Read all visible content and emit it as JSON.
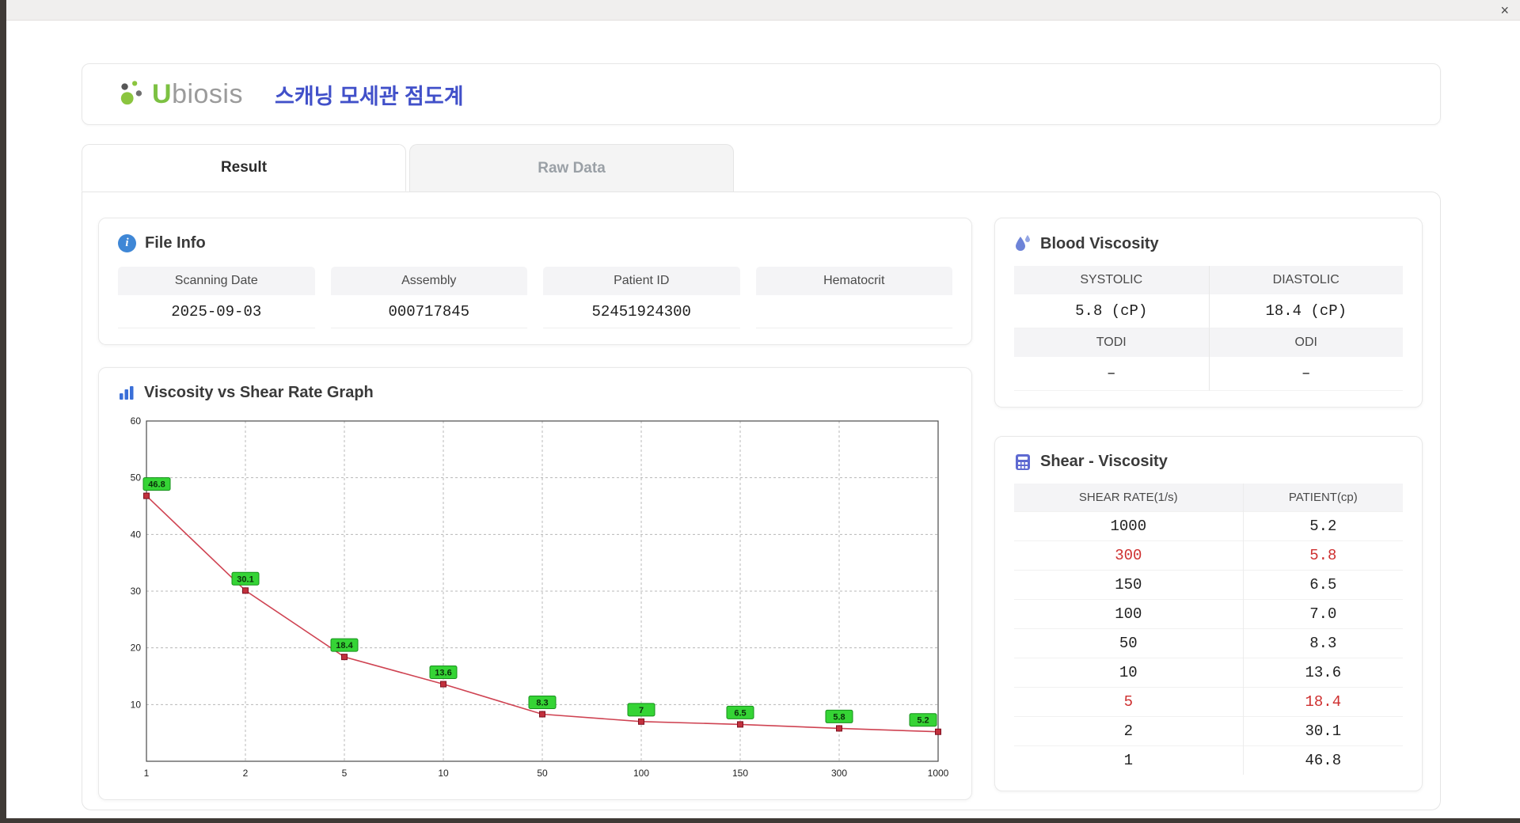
{
  "window": {
    "close_glyph": "×"
  },
  "header": {
    "logo_u": "U",
    "logo_rest": "biosis",
    "title": "스캐닝 모세관 점도계"
  },
  "tabs": [
    {
      "label": "Result",
      "active": true
    },
    {
      "label": "Raw Data",
      "active": false
    }
  ],
  "file_info": {
    "title": "File Info",
    "fields": [
      {
        "label": "Scanning Date",
        "value": "2025-09-03"
      },
      {
        "label": "Assembly",
        "value": "000717845"
      },
      {
        "label": "Patient ID",
        "value": "52451924300"
      },
      {
        "label": "Hematocrit",
        "value": ""
      }
    ]
  },
  "blood_viscosity": {
    "title": "Blood Viscosity",
    "cells": [
      {
        "label": "SYSTOLIC",
        "value": "5.8 (cP)"
      },
      {
        "label": "DIASTOLIC",
        "value": "18.4 (cP)"
      },
      {
        "label": "TODI",
        "value": "–"
      },
      {
        "label": "ODI",
        "value": "–"
      }
    ]
  },
  "graph": {
    "title": "Viscosity vs Shear Rate Graph"
  },
  "chart_data": {
    "type": "line",
    "title": "Viscosity vs Shear Rate Graph",
    "x_categories": [
      "1",
      "2",
      "5",
      "10",
      "50",
      "100",
      "150",
      "300",
      "1000"
    ],
    "values": [
      46.8,
      30.1,
      18.4,
      13.6,
      8.3,
      7,
      6.5,
      5.8,
      5.2
    ],
    "point_labels": [
      "46.8",
      "30.1",
      "18.4",
      "13.6",
      "8.3",
      "7",
      "6.5",
      "5.8",
      "5.2"
    ],
    "xlabel": "",
    "ylabel": "",
    "ylim": [
      0,
      60
    ],
    "yticks": [
      10,
      20,
      30,
      40,
      50,
      60
    ],
    "grid": "dashed",
    "legend": "none",
    "line_color": "#cf4352",
    "marker_color": "#c2313d",
    "label_bg": "#35d435",
    "label_border": "#15901a"
  },
  "shear_table": {
    "title": "Shear - Viscosity",
    "columns": [
      "SHEAR RATE(1/s)",
      "PATIENT(cp)"
    ],
    "rows": [
      {
        "shear": "1000",
        "patient": "5.2",
        "highlight": false
      },
      {
        "shear": "300",
        "patient": "5.8",
        "highlight": true
      },
      {
        "shear": "150",
        "patient": "6.5",
        "highlight": false
      },
      {
        "shear": "100",
        "patient": "7.0",
        "highlight": false
      },
      {
        "shear": "50",
        "patient": "8.3",
        "highlight": false
      },
      {
        "shear": "10",
        "patient": "13.6",
        "highlight": false
      },
      {
        "shear": "5",
        "patient": "18.4",
        "highlight": true
      },
      {
        "shear": "2",
        "patient": "30.1",
        "highlight": false
      },
      {
        "shear": "1",
        "patient": "46.8",
        "highlight": false
      }
    ]
  },
  "icons": {
    "info": "info-icon",
    "droplet": "droplet-icon",
    "bar_chart": "bar-chart-icon",
    "calculator": "calculator-icon",
    "close": "close-icon"
  },
  "colors": {
    "accent_blue": "#4150c9",
    "logo_green": "#7cc142",
    "highlight_red": "#ce2f2f",
    "header_gray": "#f4f4f6"
  }
}
